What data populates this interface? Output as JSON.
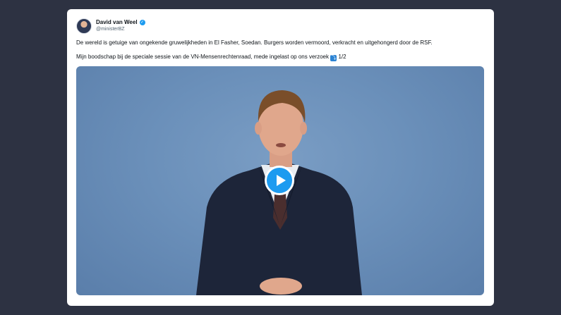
{
  "tweet": {
    "author_name": "David van Weel",
    "handle": "@ministerBZ",
    "paragraph1": "De wereld is getuige van ongekende gruwelijkheden in El Fasher, Soedan. Burgers worden vermoord, verkracht en uitgehongerd door de RSF.",
    "paragraph2": "Mijn boodschap bij de speciale sessie van de VN-Mensenrechtenraad, mede ingelast op ons verzoek",
    "arrow_emoji": "⤵",
    "thread_count": "1/2"
  },
  "colors": {
    "background": "#2d3242",
    "card": "#ffffff",
    "verified_badge": "#1d9bf0",
    "play_button": "#1d9bf0"
  },
  "icons": {
    "verified": "verified-badge-icon",
    "play": "play-icon",
    "arrow": "arrow-down-right-emoji"
  }
}
